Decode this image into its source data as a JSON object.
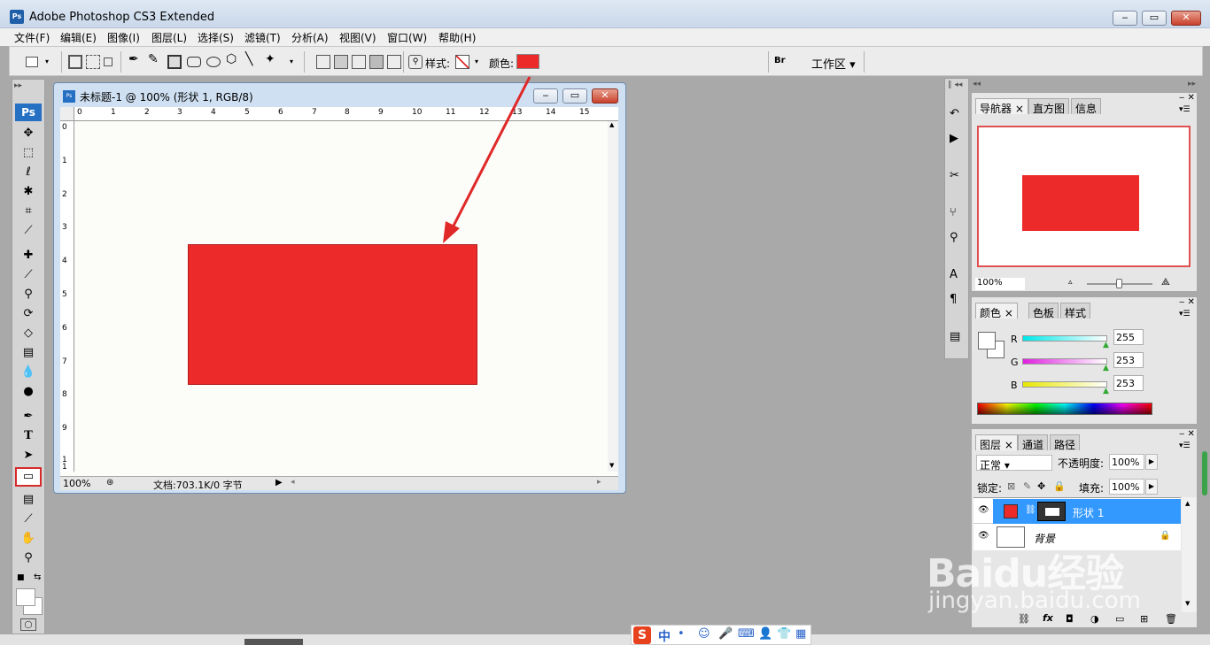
{
  "window": {
    "app_icon": "Ps",
    "title": "Adobe Photoshop CS3 Extended",
    "min": "‒",
    "max": "▭",
    "close": "✕"
  },
  "menu": [
    "文件(F)",
    "编辑(E)",
    "图像(I)",
    "图层(L)",
    "选择(S)",
    "滤镜(T)",
    "分析(A)",
    "视图(V)",
    "窗口(W)",
    "帮助(H)"
  ],
  "options": {
    "style_label": "样式:",
    "color_label": "颜色:",
    "workspace_label": "工作区 ▾",
    "shape_color": "#ec2a2a"
  },
  "tools": {
    "logo": "Ps"
  },
  "document": {
    "title": "未标题-1 @ 100% (形状 1, RGB/8)",
    "zoom": "100%",
    "status": "文档:703.1K/0 字节",
    "ruler_top": [
      "0",
      "1",
      "2",
      "3",
      "4",
      "5",
      "6",
      "7",
      "8",
      "9",
      "10",
      "11",
      "12",
      "13",
      "14",
      "15"
    ],
    "ruler_left": [
      "0",
      "1",
      "2",
      "3",
      "4",
      "5",
      "6",
      "7",
      "8",
      "9",
      "1",
      "1"
    ],
    "rect_color": "#ec2a2a"
  },
  "navigator": {
    "tabs": [
      "导航器 ×",
      "直方图",
      "信息"
    ],
    "zoom": "100%"
  },
  "color_panel": {
    "tabs": [
      "颜色 ×",
      "色板",
      "样式"
    ],
    "channels": [
      {
        "label": "R",
        "value": "255"
      },
      {
        "label": "G",
        "value": "253"
      },
      {
        "label": "B",
        "value": "253"
      }
    ]
  },
  "layers": {
    "tabs": [
      "图层 ×",
      "通道",
      "路径"
    ],
    "blend_mode": "正常 ▾",
    "opacity_label": "不透明度:",
    "opacity": "100%",
    "lock_label": "锁定:",
    "fill_label": "填充:",
    "fill": "100%",
    "rows": [
      {
        "name": "形状 1",
        "selected": true
      },
      {
        "name": "背景",
        "selected": false
      }
    ]
  },
  "watermark": {
    "brand": "Baidu经验",
    "url": "jingyan.baidu.com"
  },
  "ime": {
    "label": "中"
  }
}
